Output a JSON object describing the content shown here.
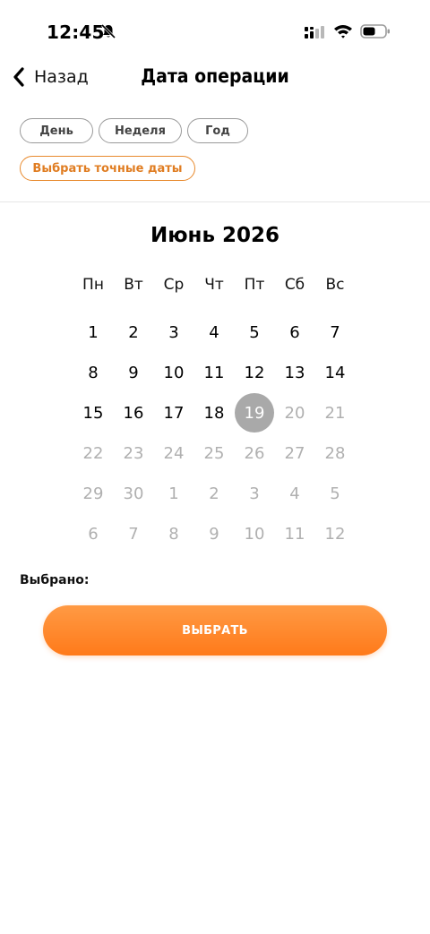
{
  "status_bar": {
    "time": "12:45",
    "icons": [
      "bell-slash-icon",
      "signal-icon",
      "wifi-icon",
      "battery-icon"
    ]
  },
  "header": {
    "back_label": "Назад",
    "title": "Дата операции"
  },
  "period_chips": {
    "day": "День",
    "week": "Неделя",
    "year": "Год",
    "exact": "Выбрать точные даты"
  },
  "calendar": {
    "month_title": "Июнь 2026",
    "weekdays": [
      "Пн",
      "Вт",
      "Ср",
      "Чт",
      "Пт",
      "Сб",
      "Вс"
    ],
    "selected_day": "19",
    "weeks": [
      [
        {
          "d": "1",
          "a": true
        },
        {
          "d": "2",
          "a": true
        },
        {
          "d": "3",
          "a": true
        },
        {
          "d": "4",
          "a": true
        },
        {
          "d": "5",
          "a": true
        },
        {
          "d": "6",
          "a": true
        },
        {
          "d": "7",
          "a": true
        }
      ],
      [
        {
          "d": "8",
          "a": true
        },
        {
          "d": "9",
          "a": true
        },
        {
          "d": "10",
          "a": true
        },
        {
          "d": "11",
          "a": true
        },
        {
          "d": "12",
          "a": true
        },
        {
          "d": "13",
          "a": true
        },
        {
          "d": "14",
          "a": true
        }
      ],
      [
        {
          "d": "15",
          "a": true
        },
        {
          "d": "16",
          "a": true
        },
        {
          "d": "17",
          "a": true
        },
        {
          "d": "18",
          "a": true
        },
        {
          "d": "19",
          "a": true,
          "s": true
        },
        {
          "d": "20",
          "a": false
        },
        {
          "d": "21",
          "a": false
        }
      ],
      [
        {
          "d": "22",
          "a": false
        },
        {
          "d": "23",
          "a": false
        },
        {
          "d": "24",
          "a": false
        },
        {
          "d": "25",
          "a": false
        },
        {
          "d": "26",
          "a": false
        },
        {
          "d": "27",
          "a": false
        },
        {
          "d": "28",
          "a": false
        }
      ],
      [
        {
          "d": "29",
          "a": false
        },
        {
          "d": "30",
          "a": false
        },
        {
          "d": "1",
          "a": false
        },
        {
          "d": "2",
          "a": false
        },
        {
          "d": "3",
          "a": false
        },
        {
          "d": "4",
          "a": false
        },
        {
          "d": "5",
          "a": false
        }
      ],
      [
        {
          "d": "6",
          "a": false
        },
        {
          "d": "7",
          "a": false
        },
        {
          "d": "8",
          "a": false
        },
        {
          "d": "9",
          "a": false
        },
        {
          "d": "10",
          "a": false
        },
        {
          "d": "11",
          "a": false
        },
        {
          "d": "12",
          "a": false
        }
      ]
    ]
  },
  "footer": {
    "selected_label": "Выбрано:",
    "select_button": "ВЫБРАТЬ"
  },
  "colors": {
    "accent": "#ff7a1a",
    "accent_text": "#e07d22",
    "inactive_day": "#b0b0b0",
    "selected_day_bg": "#a9a9a9"
  }
}
